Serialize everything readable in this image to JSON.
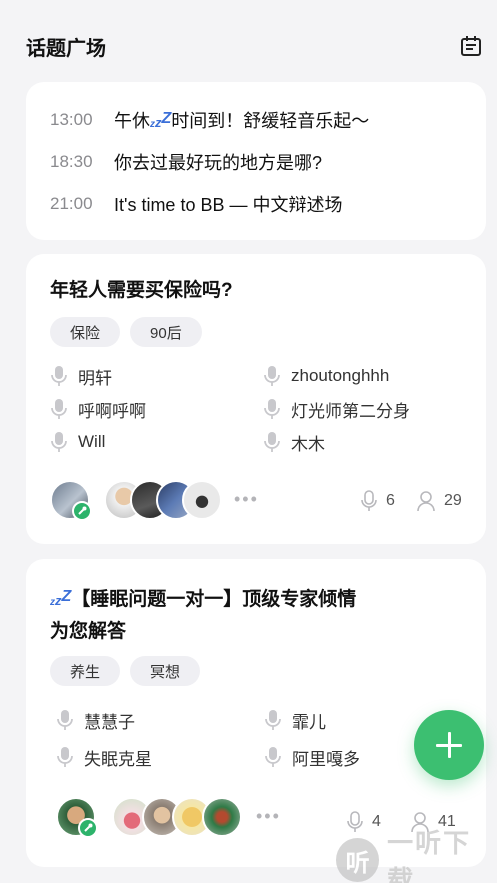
{
  "header": {
    "title": "话题广场",
    "calendar_icon": "calendar-icon"
  },
  "schedule": [
    {
      "time": "13:00",
      "title_pre": "午休",
      "title_post": "时间到！舒缓轻音乐起～",
      "has_zzz": true
    },
    {
      "time": "18:30",
      "title": "你去过最好玩的地方是哪?"
    },
    {
      "time": "21:00",
      "title": "It's time to BB — 中文辩述场"
    }
  ],
  "rooms": [
    {
      "title": "年轻人需要买保险吗?",
      "tags": [
        "保险",
        "90后"
      ],
      "speakers": [
        "明轩",
        "zhoutonghhh",
        "呼啊呼啊",
        "灯光师第二分身",
        "Will",
        "木木"
      ],
      "speaker_count": "6",
      "listener_count": "29"
    },
    {
      "title_line1": "【睡眠问题一对一】顶级专家倾情",
      "title_line2": "为您解答",
      "tags": [
        "养生",
        "冥想"
      ],
      "speakers": [
        "慧慧子",
        "霏儿",
        "失眠克星",
        "阿里嘎多"
      ],
      "speaker_count": "4",
      "listener_count": "41"
    }
  ],
  "more_dots": "•••",
  "watermark": {
    "logo": "听",
    "text": "一听下载"
  },
  "colors": {
    "accent_green": "#3cbf71",
    "zzz_blue": "#3b6fd8",
    "background": "#f4f4f6"
  }
}
